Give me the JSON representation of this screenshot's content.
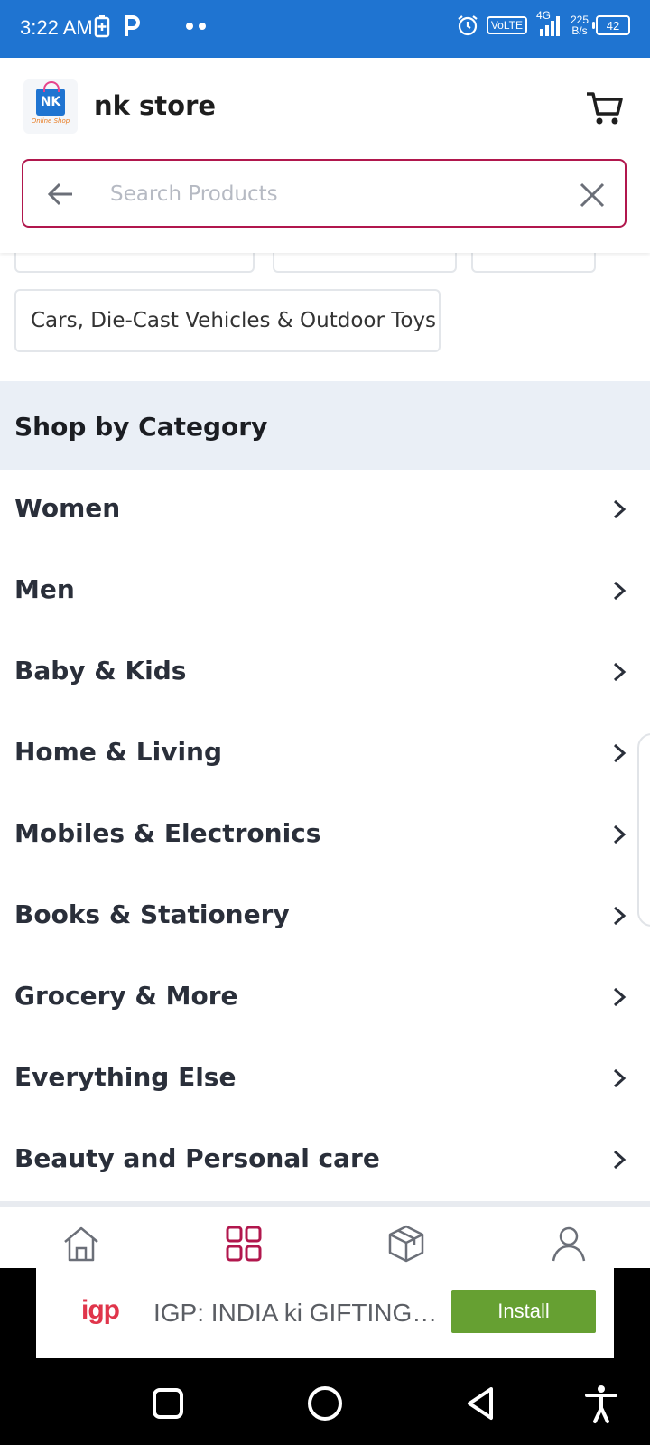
{
  "status_bar": {
    "time": "3:22 AM",
    "network_label": "VoLTE",
    "signal_label": "4G",
    "speed_value": "225",
    "speed_unit": "B/s",
    "battery": "42",
    "icons": [
      "battery-saver-icon",
      "parking-icon",
      "more-notifications-icon",
      "alarm-icon",
      "signal-icon"
    ]
  },
  "header": {
    "logo_text": "NK",
    "logo_subtext": "Online Shop",
    "store_name": "nk store",
    "cart_icon": "cart-icon"
  },
  "search": {
    "placeholder": "Search Products",
    "value": "",
    "back_icon": "arrow-left-icon",
    "clear_icon": "close-icon"
  },
  "chips": [
    {
      "label": ""
    },
    {
      "label": ""
    },
    {
      "label": ""
    },
    {
      "label": "Cars, Die-Cast Vehicles & Outdoor Toys"
    }
  ],
  "shop_by_category": {
    "title": "Shop by Category",
    "items": [
      {
        "label": "Women"
      },
      {
        "label": "Men"
      },
      {
        "label": "Baby & Kids"
      },
      {
        "label": "Home & Living"
      },
      {
        "label": "Mobiles & Electronics"
      },
      {
        "label": "Books & Stationery"
      },
      {
        "label": "Grocery & More"
      },
      {
        "label": "Everything Else"
      },
      {
        "label": "Beauty and Personal care"
      }
    ]
  },
  "bottom_nav": {
    "items": [
      "home-icon",
      "categories-icon",
      "orders-icon",
      "account-icon"
    ],
    "active_color": "#b1174d",
    "inactive_color": "#6b6f78"
  },
  "ad": {
    "brand": "igp",
    "text": "IGP: INDIA ki GIFTING APP",
    "button": "Install",
    "button_color": "#66a032"
  },
  "colors": {
    "status_bar": "#1f74d1",
    "accent": "#b1174d",
    "section_bg": "#eaeff6"
  }
}
